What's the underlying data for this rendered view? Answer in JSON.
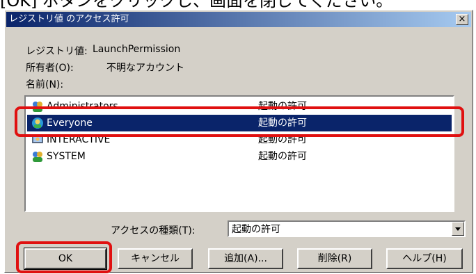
{
  "caption": "[OK] ボタンをクリックし、画面を閉じてください。",
  "dialog": {
    "title": "レジストリ値 のアクセス許可",
    "close_label": "×"
  },
  "info": {
    "registry_label": "レジストリ値:",
    "registry_value": "LaunchPermission",
    "owner_label": "所有者(O):",
    "owner_value": "不明なアカウント",
    "names_label": "名前(N):"
  },
  "list": {
    "rows": [
      {
        "name": "Administrators",
        "permission": "起動の許可",
        "icon": "group-icon"
      },
      {
        "name": "Everyone",
        "permission": "起動の許可",
        "icon": "globe-user-icon"
      },
      {
        "name": "INTERACTIVE",
        "permission": "起動の許可",
        "icon": "interactive-user-icon"
      },
      {
        "name": "SYSTEM",
        "permission": "起動の許可",
        "icon": "group-icon"
      }
    ],
    "selected_index": 1
  },
  "access": {
    "label": "アクセスの種類(T):",
    "value": "起動の許可"
  },
  "buttons": {
    "ok": "OK",
    "cancel": "キャンセル",
    "add": "追加(A)...",
    "remove": "削除(R)",
    "help": "ヘルプ(H)"
  },
  "colors": {
    "selection": "#0a246a",
    "highlight": "#e01010",
    "dialog_bg": "#d4d0c8"
  }
}
